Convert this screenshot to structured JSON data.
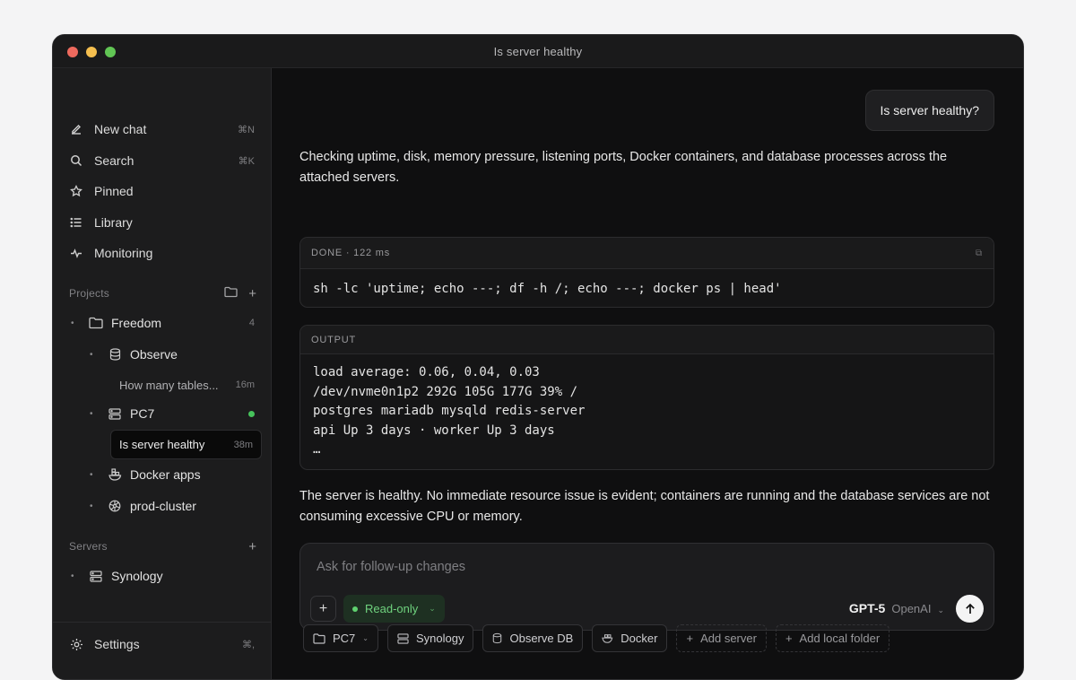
{
  "window": {
    "title": "Is server healthy"
  },
  "sidebar": {
    "nav": [
      {
        "label": "New chat",
        "shortcut": "⌘N",
        "icon": "edit-icon"
      },
      {
        "label": "Search",
        "shortcut": "⌘K",
        "icon": "search-icon"
      },
      {
        "label": "Pinned",
        "shortcut": "",
        "icon": "star-icon"
      },
      {
        "label": "Library",
        "shortcut": "",
        "icon": "list-icon"
      },
      {
        "label": "Monitoring",
        "shortcut": "",
        "icon": "pulse-icon"
      }
    ],
    "projects_label": "Projects",
    "projects": {
      "freedom": {
        "label": "Freedom",
        "count": "4"
      },
      "observe": {
        "label": "Observe"
      },
      "observe_chat": {
        "label": "How many tables...",
        "time": "16m"
      },
      "pc7": {
        "label": "PC7",
        "status_color": "#46c25b"
      },
      "pc7_chat": {
        "label": "Is server healthy",
        "time": "38m"
      },
      "docker": {
        "label": "Docker apps"
      },
      "cluster": {
        "label": "prod-cluster"
      }
    },
    "servers_label": "Servers",
    "servers": [
      {
        "label": "Synology"
      }
    ],
    "settings": {
      "label": "Settings",
      "shortcut": "⌘,"
    }
  },
  "conversation": {
    "user_message": "Is server healthy?",
    "intro": "Checking uptime, disk, memory pressure, listening ports, Docker containers, and database processes across the attached servers.",
    "command_card": {
      "status": "DONE · 122 ms",
      "command": "sh -lc 'uptime; echo ---; df -h /; echo ---; docker ps | head'"
    },
    "output_card": {
      "label": "OUTPUT",
      "lines": [
        "load average: 0.06, 0.04, 0.03",
        "/dev/nvme0n1p2  292G  105G  177G  39% /",
        "postgres  mariadb  mysqld  redis-server",
        "api  Up 3 days · worker  Up 3 days",
        "…"
      ]
    },
    "answer": "The server is healthy. No immediate resource issue is evident; containers are running and the database services are not consuming excessive CPU or memory."
  },
  "composer": {
    "placeholder": "Ask for follow-up changes",
    "mode": "Read-only",
    "model": "GPT-5",
    "provider": "OpenAI"
  },
  "context_chips": [
    {
      "label": "PC7"
    },
    {
      "label": "Synology"
    },
    {
      "label": "Observe DB"
    },
    {
      "label": "Docker"
    },
    {
      "label": "Add server"
    },
    {
      "label": "Add local folder"
    }
  ],
  "colors": {
    "accent_green": "#46c25b",
    "background": "#0f0f10",
    "sidebar": "#1c1c1d"
  }
}
